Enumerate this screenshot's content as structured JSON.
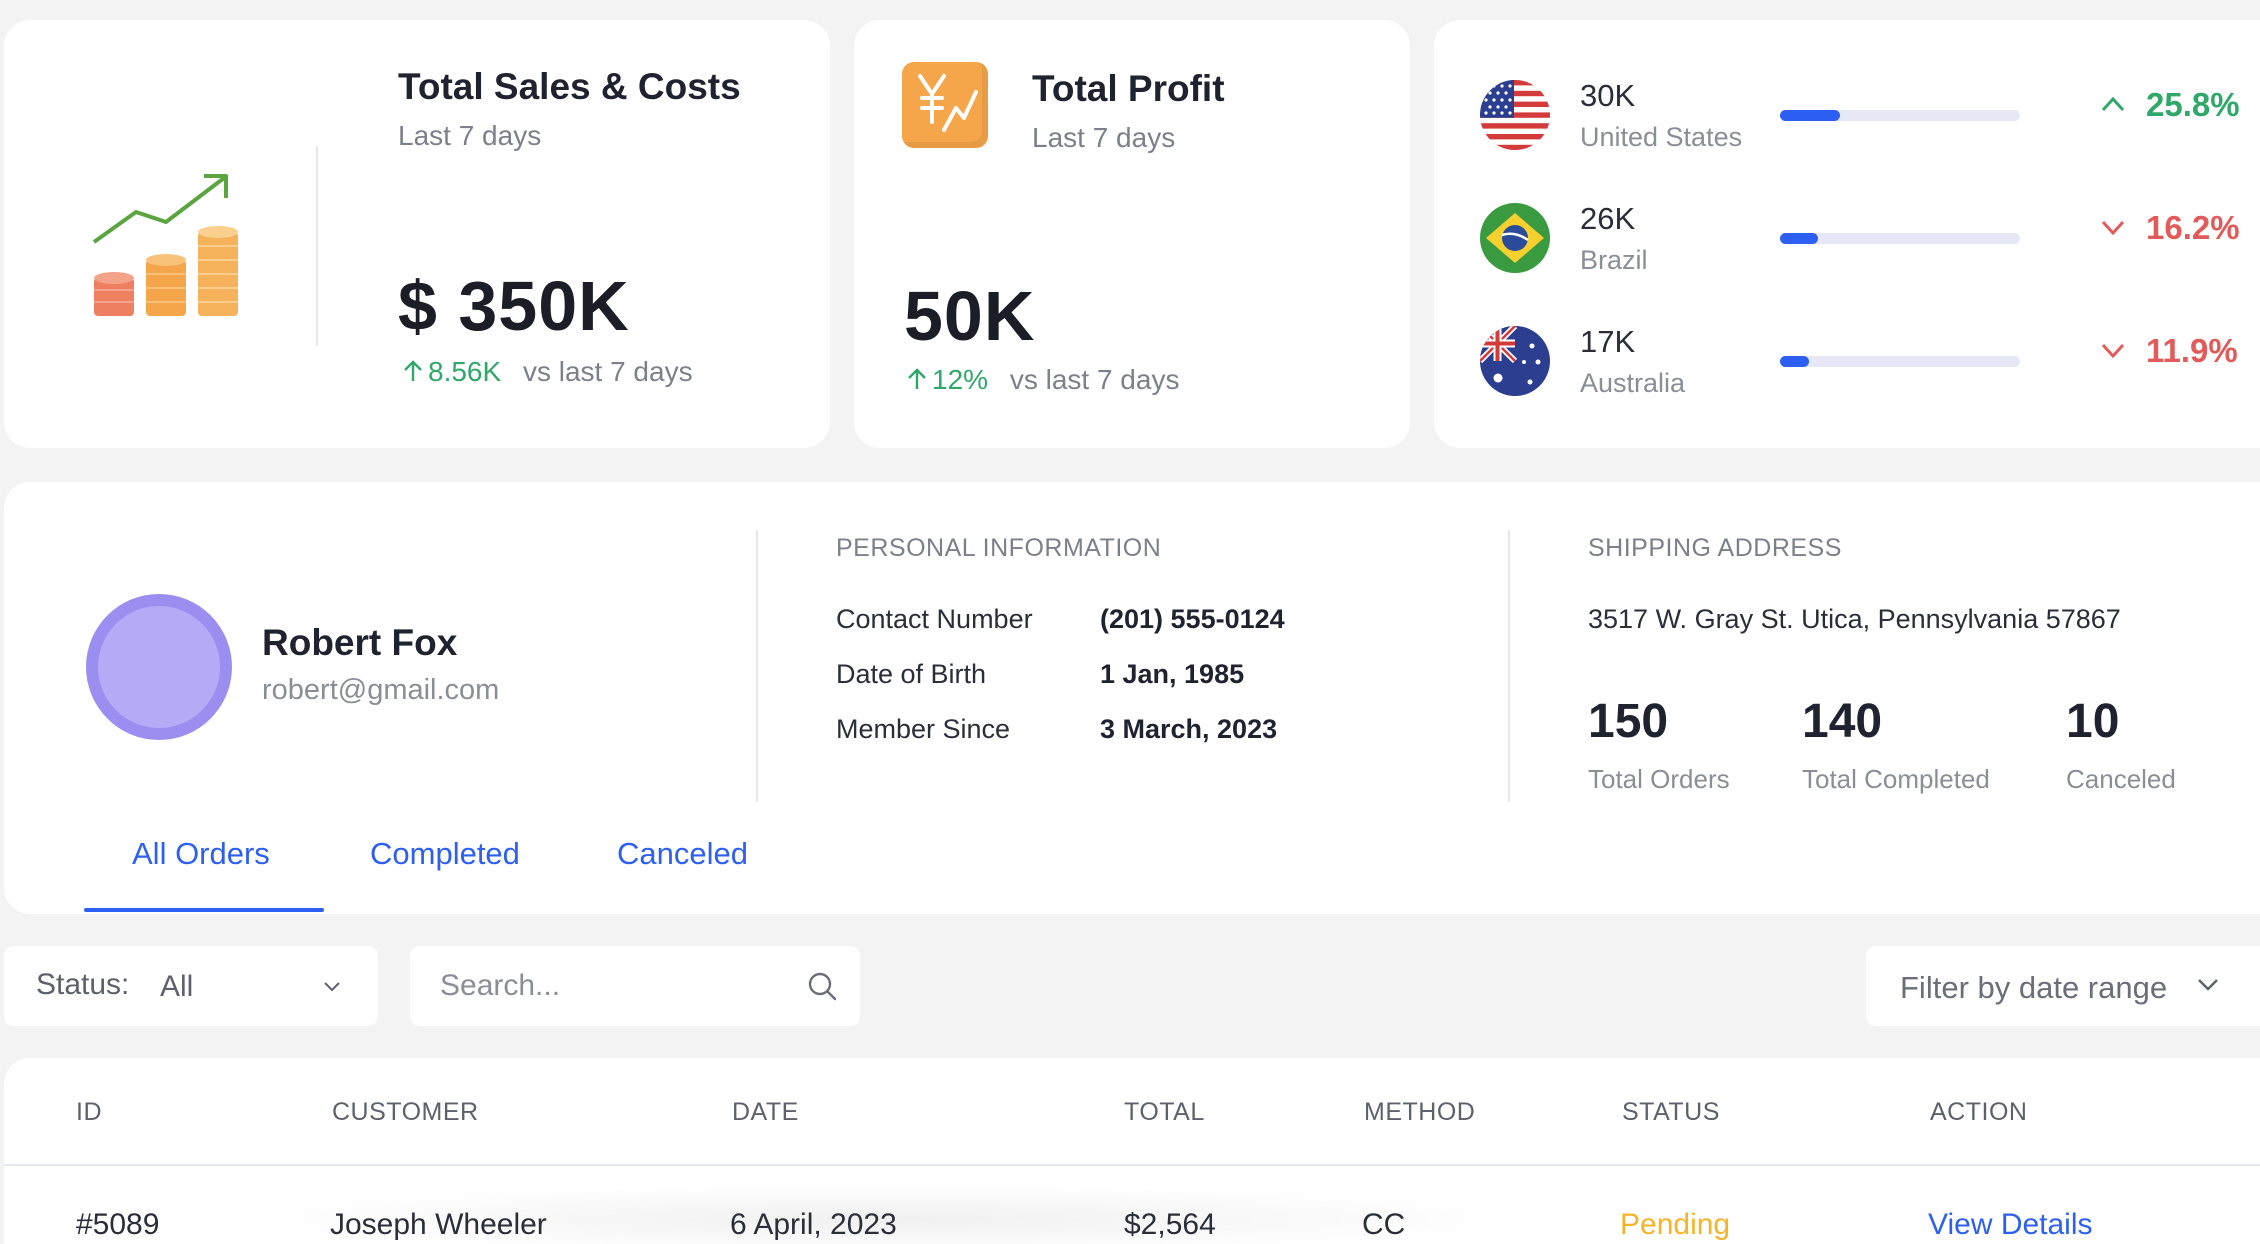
{
  "sales_card": {
    "title": "Total Sales & Costs",
    "subtitle": "Last 7 days",
    "value": "$ 350K",
    "change": "8.56K",
    "comparison": "vs last 7 days",
    "icon": "coins-growth-icon"
  },
  "profit_card": {
    "title": "Total Profit",
    "subtitle": "Last 7 days",
    "value": "50K",
    "change": "12%",
    "comparison": "vs last 7 days",
    "icon": "yen-chart-icon"
  },
  "countries": [
    {
      "value": "30K",
      "name": "United States",
      "change": "25.8%",
      "direction": "up",
      "progress": 0.25,
      "flag": "us-flag-icon"
    },
    {
      "value": "26K",
      "name": "Brazil",
      "change": "16.2%",
      "direction": "down",
      "progress": 0.16,
      "flag": "brazil-flag-icon"
    },
    {
      "value": "17K",
      "name": "Australia",
      "change": "11.9%",
      "direction": "down",
      "progress": 0.12,
      "flag": "australia-flag-icon"
    }
  ],
  "customer": {
    "name": "Robert Fox",
    "email": "robert@gmail.com",
    "personal_heading": "PERSONAL INFORMATION",
    "contact_label": "Contact Number",
    "contact_value": "(201) 555-0124",
    "dob_label": "Date of Birth",
    "dob_value": "1 Jan, 1985",
    "member_label": "Member Since",
    "member_value": "3 March, 2023",
    "shipping_heading": "SHIPPING ADDRESS",
    "address": "3517 W. Gray St. Utica, Pennsylvania 57867",
    "stats": [
      {
        "value": "150",
        "label": "Total Orders"
      },
      {
        "value": "140",
        "label": "Total Completed"
      },
      {
        "value": "10",
        "label": "Canceled"
      }
    ]
  },
  "tabs": [
    {
      "label": "All Orders",
      "active": true
    },
    {
      "label": "Completed",
      "active": false
    },
    {
      "label": "Canceled",
      "active": false
    }
  ],
  "filters": {
    "status_label": "Status:",
    "status_value": "All",
    "search_placeholder": "Search...",
    "date_range": "Filter by date range"
  },
  "table": {
    "headers": [
      "ID",
      "CUSTOMER",
      "DATE",
      "TOTAL",
      "METHOD",
      "STATUS",
      "ACTION"
    ],
    "rows": [
      {
        "id": "#5089",
        "customer": "Joseph Wheeler",
        "date": "6 April, 2023",
        "total": "$2,564",
        "method": "CC",
        "status": "Pending",
        "action": "View Details"
      }
    ]
  },
  "colors": {
    "accent": "#2d5ff3",
    "positive": "#2fa86a",
    "negative": "#e35a5a",
    "pending": "#f4b528"
  }
}
